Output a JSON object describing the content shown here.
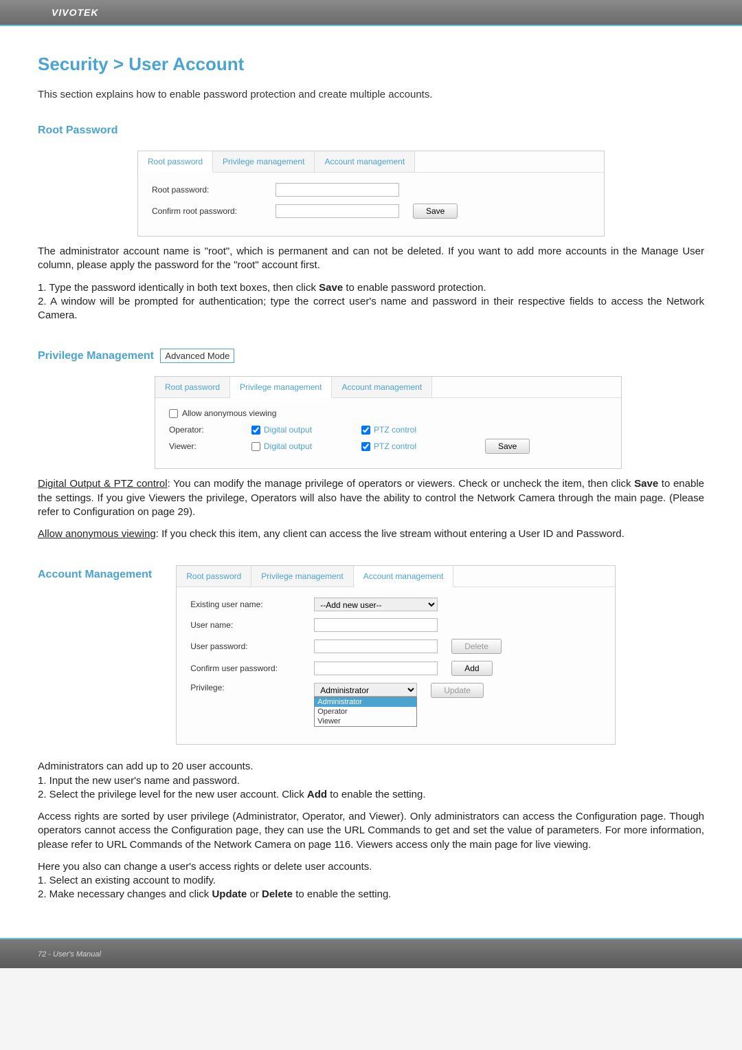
{
  "brand": "VIVOTEK",
  "page_title": "Security > User Account",
  "intro_text": "This section explains how to enable password protection and create multiple accounts.",
  "root_pw_section": {
    "title": "Root Password",
    "tabs": {
      "t1": "Root password",
      "t2": "Privilege management",
      "t3": "Account management"
    },
    "labels": {
      "root_pw": "Root password:",
      "confirm": "Confirm root password:"
    },
    "save_btn": "Save"
  },
  "root_pw_explain": {
    "p1": "The administrator account name is \"root\", which is permanent and can not be deleted. If you want to add more accounts in the Manage User column, please apply the password for the \"root\" account first.",
    "l1": "1. Type the password identically in both text boxes, then click ",
    "l1b": "Save",
    "l1c": " to enable password protection.",
    "l2": "2. A window will be prompted for authentication; type the correct user's name and password in their respective fields to access the Network Camera."
  },
  "priv_mgmt": {
    "title": "Privilege Management",
    "adv_mode": "Advanced Mode",
    "tabs": {
      "t1": "Root password",
      "t2": "Privilege management",
      "t3": "Account management"
    },
    "anon": "Allow anonymous viewing",
    "operator": "Operator:",
    "viewer": "Viewer:",
    "digital_output": "Digital output",
    "ptz_control": "PTZ control",
    "save_btn": "Save"
  },
  "priv_explain": {
    "head1": "Digital Output & PTZ control",
    "p1": ": You can modify the manage privilege of operators or viewers. Check or uncheck the item, then click ",
    "p1b": "Save",
    "p1c": " to enable the settings. If you give Viewers the privilege, Operators will also have the ability to control the Network Camera through the main page. (Please refer to Configuration on page 29).",
    "head2": "Allow anonymous viewing",
    "p2": ": If you check this item, any client can access the live stream without entering a User ID and Password."
  },
  "acct_mgmt": {
    "title": "Account Management",
    "tabs": {
      "t1": "Root password",
      "t2": "Privilege management",
      "t3": "Account management"
    },
    "labels": {
      "existing": "Existing user name:",
      "user_name": "User name:",
      "user_pw": "User password:",
      "confirm_pw": "Confirm user password:",
      "privilege": "Privilege:"
    },
    "existing_value": "--Add new user--",
    "priv_value": "Administrator",
    "dropdown": {
      "opt1": "Administrator",
      "opt2": "Operator",
      "opt3": "Viewer"
    },
    "buttons": {
      "delete": "Delete",
      "add": "Add",
      "update": "Update"
    }
  },
  "acct_explain": {
    "p1": "Administrators can add up to 20 user accounts.",
    "l1": "1. Input the new user's name and password.",
    "l2a": "2. Select the privilege level for the new user account. Click ",
    "l2b": "Add",
    "l2c": " to enable the setting.",
    "p2": "Access rights are sorted by user privilege (Administrator, Operator, and Viewer). Only administrators can access the Configuration page. Though operators cannot access the Configuration page, they can use the URL Commands to get and set the value of parameters. For more information, please refer to URL Commands of the Network Camera on page 116. Viewers access only the main page for live viewing.",
    "p3": "Here you also can change a user's access rights or delete user accounts.",
    "l3": "1. Select an existing account to modify.",
    "l4a": "2. Make necessary changes and click ",
    "l4b": "Update",
    "l4c": " or ",
    "l4d": "Delete",
    "l4e": " to enable the setting."
  },
  "footer": "72 - User's Manual"
}
